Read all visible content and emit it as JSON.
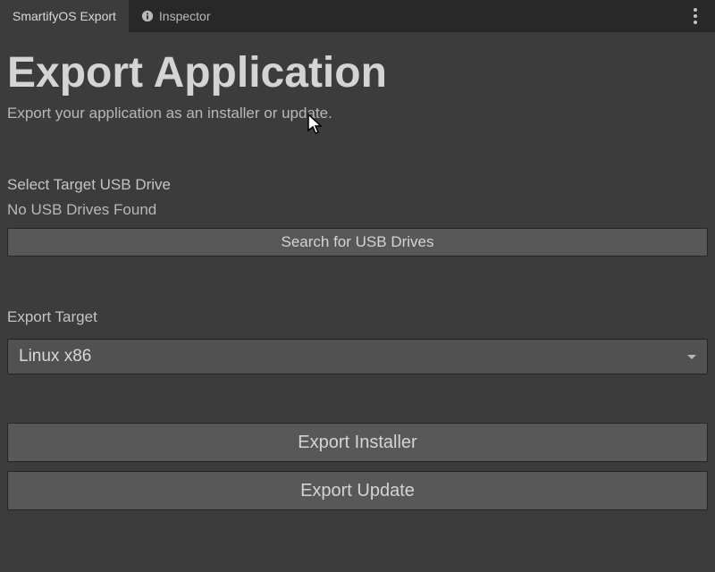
{
  "tabs": {
    "export": "SmartifyOS Export",
    "inspector": "Inspector"
  },
  "header": {
    "title": "Export Application",
    "subtitle": "Export your application as an installer or update."
  },
  "usb": {
    "label": "Select Target USB Drive",
    "status": "No USB Drives Found",
    "searchButton": "Search for USB Drives"
  },
  "target": {
    "label": "Export Target",
    "selected": "Linux x86"
  },
  "actions": {
    "installer": "Export Installer",
    "update": "Export Update"
  }
}
